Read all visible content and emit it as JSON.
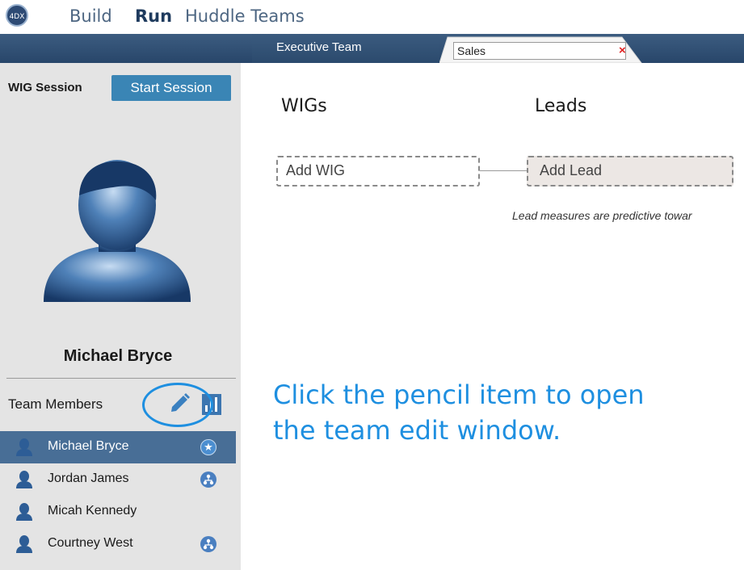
{
  "nav": {
    "items": [
      {
        "label": "Build"
      },
      {
        "label": "Run"
      },
      {
        "label": "Huddle Teams"
      }
    ]
  },
  "tabs": {
    "executive": "Executive Team",
    "sales_value": "Sales",
    "close_glyph": "×"
  },
  "session": {
    "label": "WIG Session",
    "start_button": "Start Session"
  },
  "selected_member": "Michael Bryce",
  "team": {
    "label": "Team Members",
    "members": [
      {
        "name": "Michael Bryce",
        "badge": "star-icon",
        "selected": true
      },
      {
        "name": "Jordan James",
        "badge": "org-icon"
      },
      {
        "name": "Micah Kennedy",
        "badge": ""
      },
      {
        "name": "Courtney West",
        "badge": "org-icon"
      }
    ]
  },
  "main": {
    "wigs_heading": "WIGs",
    "leads_heading": "Leads",
    "add_wig": "Add WIG",
    "add_lead": "Add Lead",
    "lead_note": "Lead measures are predictive towar"
  },
  "callout": "Click the pencil item to open the team edit window.",
  "colors": {
    "tabbar": "#2f4f74",
    "accent": "#3a85b5",
    "selected_row": "#486e96",
    "callout": "#1e8fe0"
  }
}
